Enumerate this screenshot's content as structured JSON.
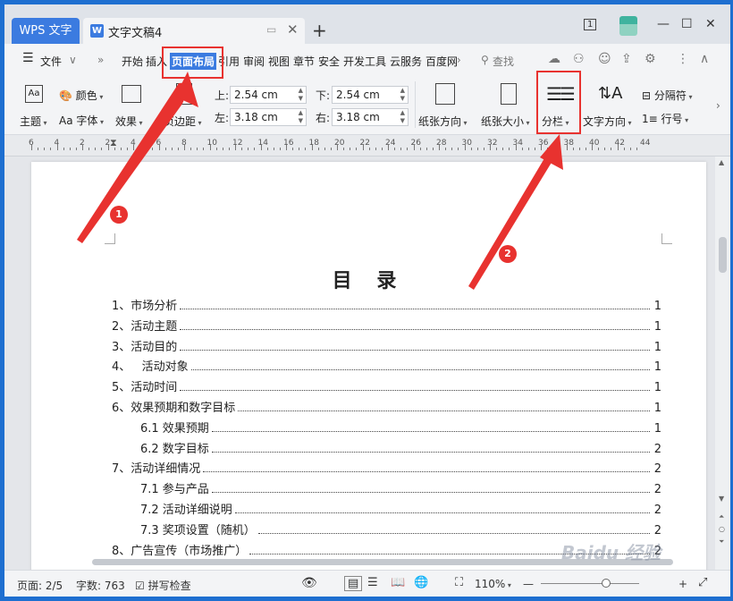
{
  "tabs": {
    "app_tab": "WPS 文字",
    "doc_icon": "W",
    "doc_title": "文字文稿4",
    "add_tab": "+",
    "badge_count": "1"
  },
  "menu": {
    "file": "文件",
    "more": "»",
    "items": [
      "开始",
      "插入",
      "页面布局",
      "引用",
      "审阅",
      "视图",
      "章节",
      "安全",
      "开发工具",
      "云服务",
      "百度网"
    ],
    "active": "页面布局",
    "search": "查找"
  },
  "ribbon": {
    "theme": "主题",
    "colors": "颜色",
    "font": "字体",
    "effects": "效果",
    "margins": "页边距",
    "top_label": "上:",
    "top_value": "2.54 cm",
    "bottom_label": "下:",
    "bottom_value": "2.54 cm",
    "left_label": "左:",
    "left_value": "3.18 cm",
    "right_label": "右:",
    "right_value": "3.18 cm",
    "orientation": "纸张方向",
    "size": "纸张大小",
    "columns": "分栏",
    "text_direction": "文字方向",
    "breaks": "分隔符",
    "line_numbers": "行号"
  },
  "ruler": {
    "numbers": [
      "6",
      "4",
      "2",
      "2",
      "4",
      "6",
      "8",
      "10",
      "12",
      "14",
      "16",
      "18",
      "20",
      "22",
      "24",
      "26",
      "28",
      "30",
      "32",
      "34",
      "36",
      "38",
      "40",
      "42",
      "44"
    ]
  },
  "document": {
    "toc_title": "目 录",
    "toc": [
      {
        "label": "1、市场分析",
        "page": "1",
        "indent": 0
      },
      {
        "label": "2、活动主题",
        "page": "1",
        "indent": 0
      },
      {
        "label": "3、活动目的",
        "page": "1",
        "indent": 0
      },
      {
        "label": "4、   活动对象",
        "page": "1",
        "indent": 0
      },
      {
        "label": "5、活动时间",
        "page": "1",
        "indent": 0
      },
      {
        "label": "6、效果预期和数字目标",
        "page": "1",
        "indent": 0
      },
      {
        "label": "6.1 效果预期",
        "page": "1",
        "indent": 1
      },
      {
        "label": "6.2 数字目标",
        "page": "2",
        "indent": 1
      },
      {
        "label": "7、活动详细情况",
        "page": "2",
        "indent": 0
      },
      {
        "label": "7.1 参与产品",
        "page": "2",
        "indent": 1
      },
      {
        "label": "7.2 活动详细说明",
        "page": "2",
        "indent": 1
      },
      {
        "label": "7.3 奖项设置（随机）",
        "page": "2",
        "indent": 1
      },
      {
        "label": "8、广告宣传（市场推广）",
        "page": "2",
        "indent": 0
      }
    ]
  },
  "status": {
    "page": "页面: 2/5",
    "words": "字数: 763",
    "spell": "拼写检查",
    "zoom": "110%"
  },
  "annotations": {
    "step1": "1",
    "step2": "2",
    "watermark": "Baidu 经验"
  },
  "colors": {
    "accent": "#3b7be0",
    "annotation": "#e8322f"
  }
}
